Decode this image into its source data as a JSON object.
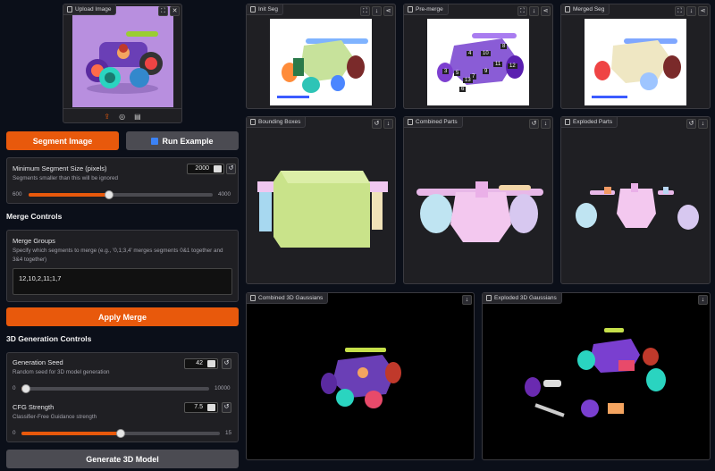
{
  "upload": {
    "label": "Upload Image"
  },
  "buttons": {
    "segment": "Segment Image",
    "run_example": "Run Example",
    "apply_merge": "Apply Merge",
    "generate": "Generate 3D Model"
  },
  "min_segment": {
    "title": "Minimum Segment Size (pixels)",
    "desc": "Segments smaller than this will be ignored",
    "value": "2000",
    "min": "600",
    "max": "4000"
  },
  "merge": {
    "header": "Merge Controls",
    "title": "Merge Groups",
    "desc": "Specify which segments to merge (e.g., '0,1;3,4' merges segments 0&1 together and 3&4 together)",
    "value": "12,10,2,11;1,7"
  },
  "gen": {
    "header": "3D Generation Controls",
    "seed": {
      "title": "Generation Seed",
      "desc": "Random seed for 3D model generation",
      "value": "42",
      "min": "0",
      "max": "10000"
    },
    "cfg": {
      "title": "CFG Strength",
      "desc": "Classifier-Free Guidance strength",
      "value": "7.5",
      "min": "0",
      "max": "15"
    }
  },
  "panels": {
    "init_seg": "Init Seg",
    "pre_merge": "Pre-merge",
    "merged_seg": "Merged Seg",
    "bboxes": "Bounding Boxes",
    "combined_parts": "Combined Parts",
    "exploded_parts": "Exploded Parts",
    "combined_gauss": "Combined 3D Gaussians",
    "exploded_gauss": "Exploded 3D Gaussians"
  },
  "segment_labels": [
    "3",
    "4",
    "5",
    "6",
    "7",
    "8",
    "9",
    "10",
    "11",
    "12",
    "13"
  ],
  "icons": {
    "upload": "upload-icon",
    "webcam": "webcam-icon",
    "clipboard": "clipboard-icon",
    "fullscreen": "fullscreen-icon",
    "close": "close-icon",
    "download": "download-icon",
    "share": "share-icon",
    "reset": "reset-icon",
    "model": "model-icon",
    "image": "image-icon"
  },
  "colors": {
    "accent": "#e8590c",
    "bg": "#0b0f19",
    "panel": "#1f1f23",
    "upload_bg": "#b88fdf"
  }
}
